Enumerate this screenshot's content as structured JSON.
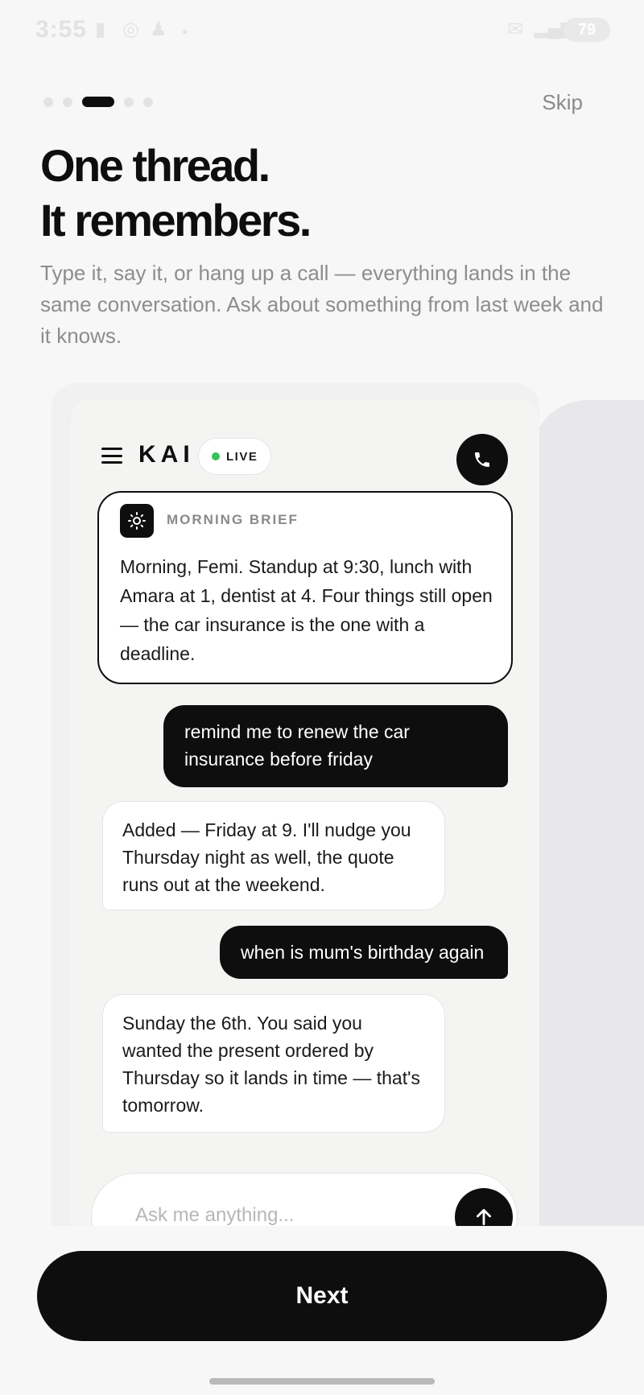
{
  "status_bar": {
    "time": "3:55",
    "battery": "79"
  },
  "onboarding": {
    "skip_label": "Skip",
    "title_line1": "One thread.",
    "title_line2": "It remembers.",
    "subtitle": "Type it, say it, or hang up a call — everything lands in the same conversation. Ask about something from last week and it knows.",
    "pager": {
      "count": 5,
      "active_index": 2
    },
    "next_label": "Next"
  },
  "mock_app": {
    "brand": "KAI",
    "live_label": "LIVE",
    "brief": {
      "label": "MORNING BRIEF",
      "text": "Morning, Femi. Standup at 9:30, lunch with Amara at 1, dentist at 4. Four things still open — the car insurance is the one with a deadline."
    },
    "messages": [
      {
        "role": "user",
        "text": "remind me to renew the car insurance before friday"
      },
      {
        "role": "assistant",
        "text": "Added — Friday at 9. I'll nudge you Thursday night as well, the quote runs out at the weekend."
      },
      {
        "role": "user",
        "text": "when is mum's birthday again"
      },
      {
        "role": "assistant",
        "text": "Sunday the 6th. You said you wanted the present ordered by Thursday so it lands in time — that's tomorrow."
      }
    ],
    "input_placeholder": "Ask me anything..."
  },
  "icons": {
    "menu": "hamburger-icon",
    "call": "phone-icon",
    "brief": "sun-icon",
    "send": "arrow-up-icon"
  },
  "colors": {
    "accent": "#0e0e0e",
    "live_dot": "#36c15a",
    "background": "#f7f7f7"
  }
}
